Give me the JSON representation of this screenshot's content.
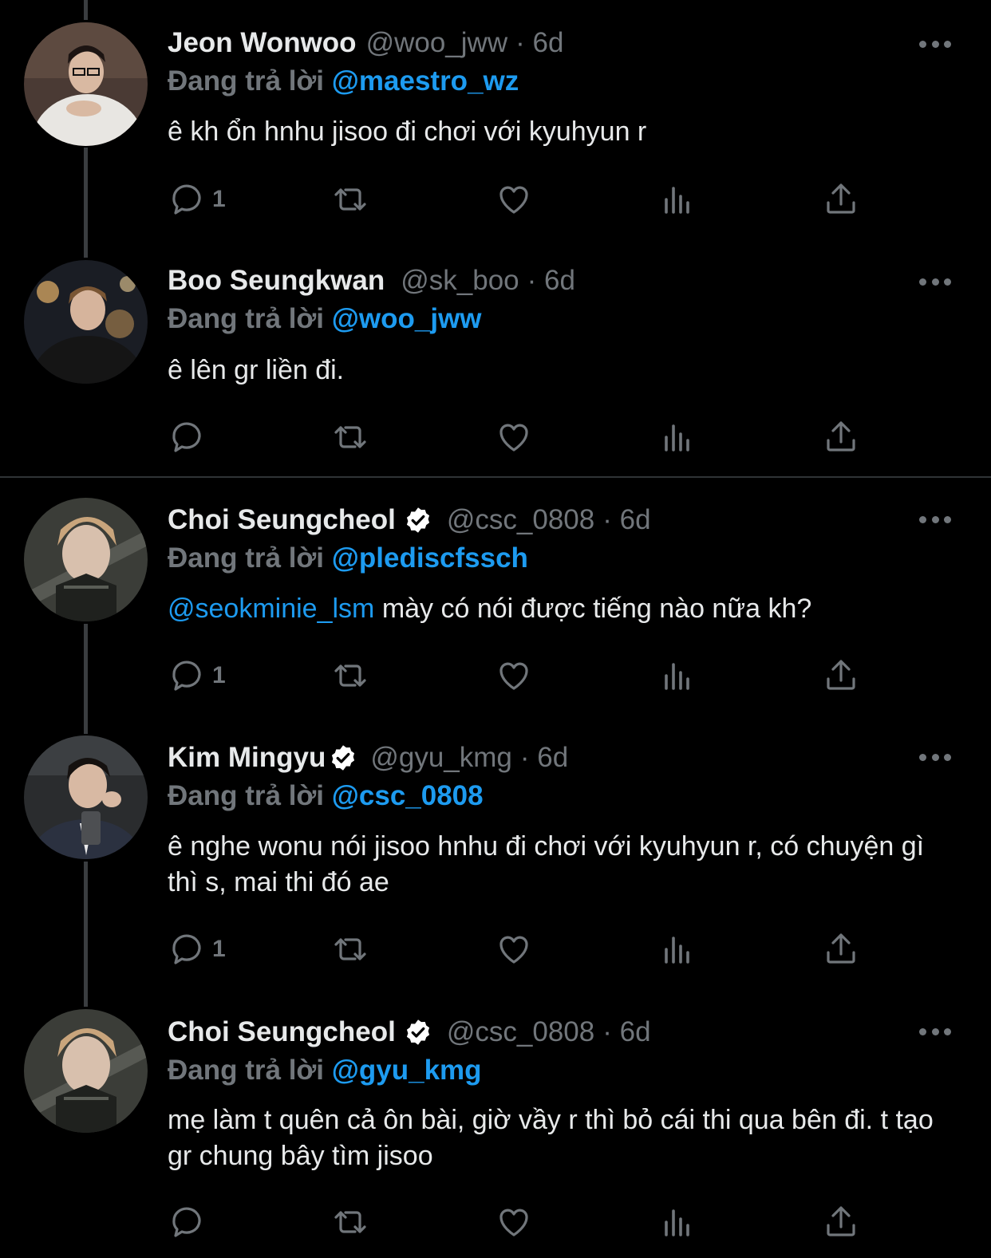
{
  "theme": {
    "background": "#000000",
    "text": "#e7e9ea",
    "muted": "#71767b",
    "accent": "#1d9bf0",
    "verified": "#ffffff"
  },
  "tweets": [
    {
      "name": "Jeon Wonwoo",
      "handle": "@woo_jww",
      "time": "· 6d",
      "verified": false,
      "replying_prefix": "Đang trả lời",
      "replying_to": "@maestro_wz",
      "mention": "",
      "text": "ê kh ổn hnhu jisoo đi chơi với kyuhyun r",
      "reply_count": "1"
    },
    {
      "name": "Boo Seungkwan",
      "handle": "@sk_boo",
      "time": "· 6d",
      "verified": false,
      "replying_prefix": "Đang trả lời",
      "replying_to": "@woo_jww",
      "mention": "",
      "text": "ê lên gr liền đi.",
      "reply_count": ""
    },
    {
      "name": "Choi Seungcheol",
      "handle": "@csc_0808",
      "time": "· 6d",
      "verified": true,
      "replying_prefix": "Đang trả lời",
      "replying_to": "@pledis‌cfssch",
      "mention": "@seokminie_lsm",
      "text": " mày có nói được tiếng nào nữa kh?",
      "reply_count": "1"
    },
    {
      "name": "Kim Mingyu",
      "handle": "@gyu_kmg",
      "time": "· 6d",
      "verified": true,
      "replying_prefix": "Đang trả lời",
      "replying_to": "@csc_0808",
      "mention": "",
      "text": "ê nghe wonu nói jisoo hnhu đi chơi với kyuhyun r, có chuyện gì thì s, mai thi đó ae",
      "reply_count": "1"
    },
    {
      "name": "Choi Seungcheol",
      "handle": "@csc_0808",
      "time": "· 6d",
      "verified": true,
      "replying_prefix": "Đang trả lời",
      "replying_to": "@gyu_kmg",
      "mention": "",
      "text": "mẹ làm t quên cả ôn bài, giờ vầy r thì bỏ cái thi qua bên đi. t tạo gr chung bây tìm jisoo",
      "reply_count": ""
    }
  ]
}
